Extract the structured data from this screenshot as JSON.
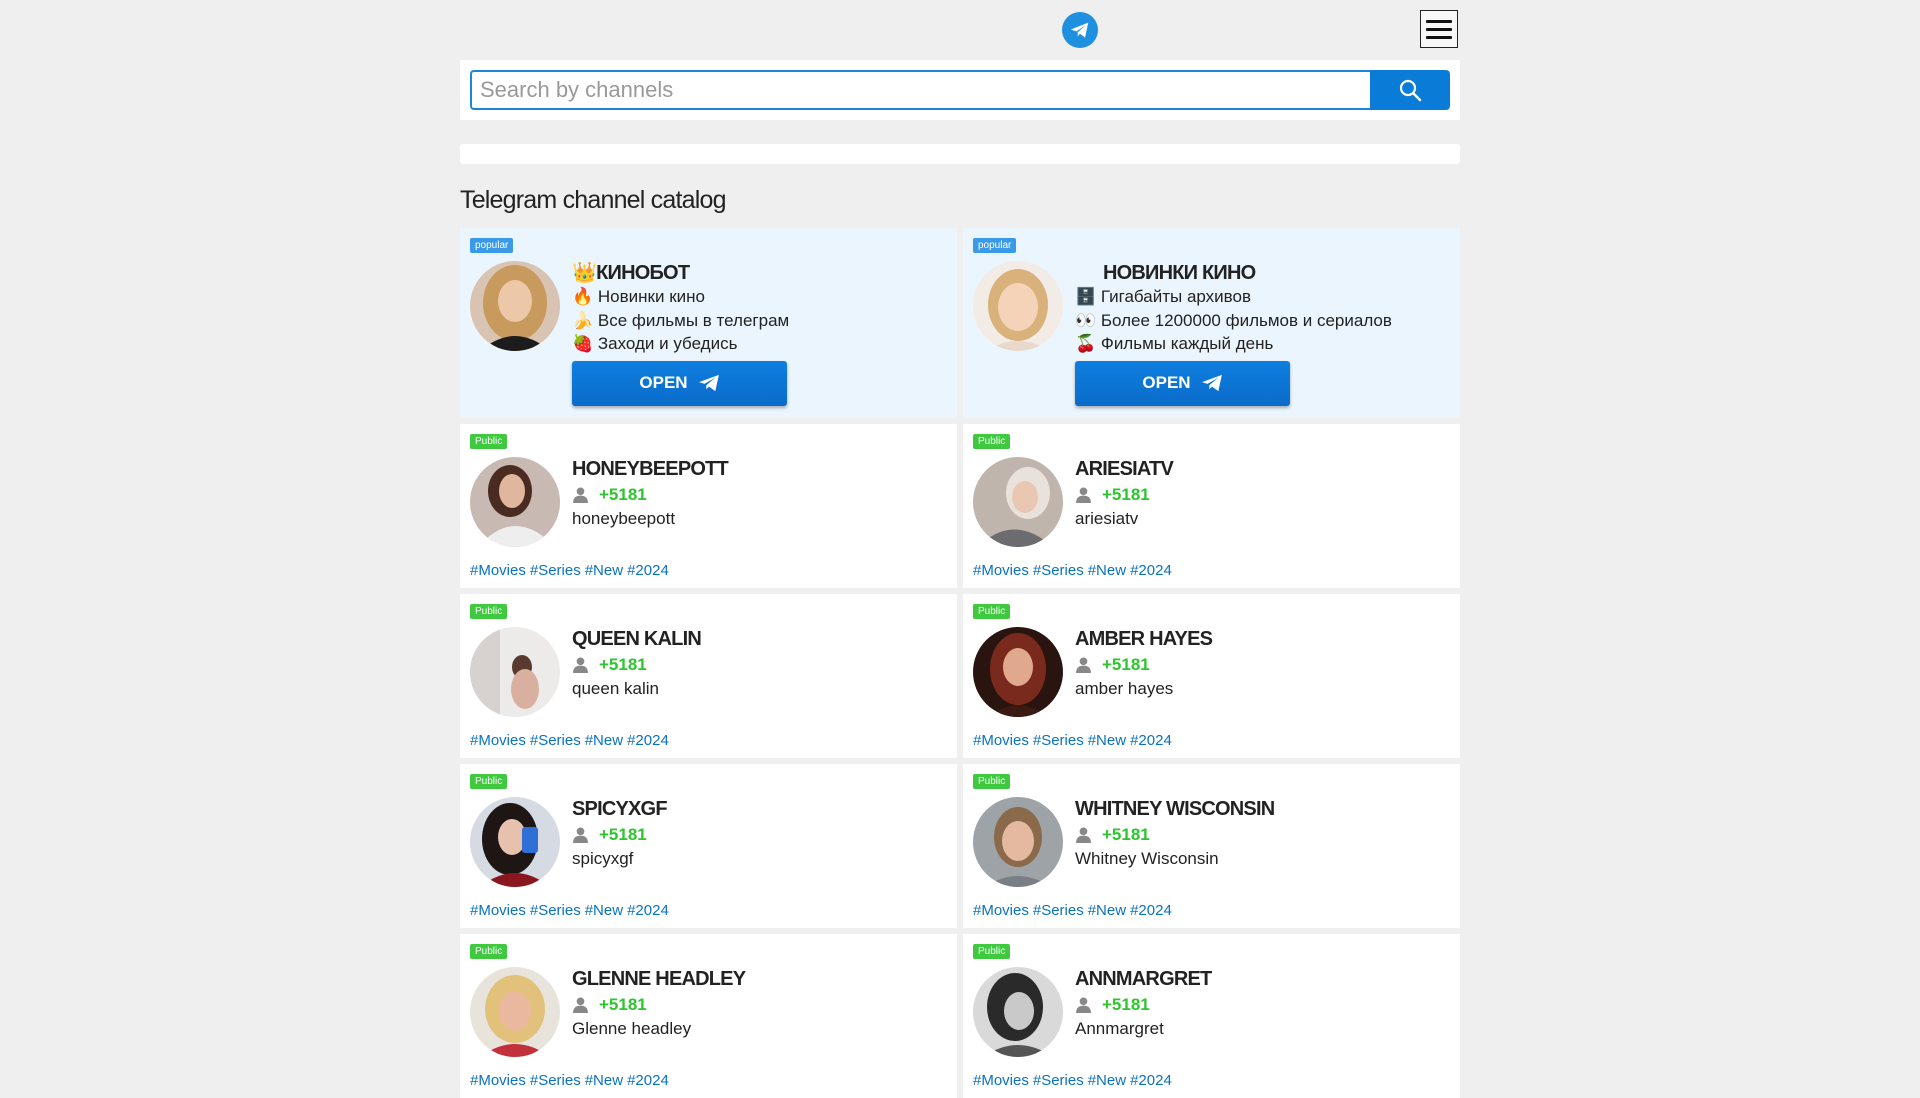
{
  "search": {
    "placeholder": "Search by channels"
  },
  "catalog_title": "Telegram channel catalog",
  "popular": [
    {
      "badge": "popular",
      "title": "👑КИНОБОТ",
      "lines": [
        "🔥 Новинки кино",
        "🍌 Все фильмы в телеграм",
        "🍓 Заходи и убедись"
      ],
      "button": "OPEN"
    },
    {
      "badge": "popular",
      "title": "НОВИНКИ КИНО",
      "lines": [
        "🗄️ Гигабайты архивов",
        "👀 Более 1200000 фильмов и сериалов",
        "🍒 Фильмы каждый день"
      ],
      "button": "OPEN"
    }
  ],
  "channels": [
    {
      "badge": "Public",
      "title": "HONEYBEEPOTT",
      "members": "+5181",
      "username": "honeybeepott",
      "tags": [
        "#Movies",
        "#Series",
        "#New",
        "#2024"
      ]
    },
    {
      "badge": "Public",
      "title": "ARIESIATV",
      "members": "+5181",
      "username": "ariesiatv",
      "tags": [
        "#Movies",
        "#Series",
        "#New",
        "#2024"
      ]
    },
    {
      "badge": "Public",
      "title": "QUEEN KALIN",
      "members": "+5181",
      "username": "queen kalin",
      "tags": [
        "#Movies",
        "#Series",
        "#New",
        "#2024"
      ]
    },
    {
      "badge": "Public",
      "title": "AMBER HAYES",
      "members": "+5181",
      "username": "amber hayes",
      "tags": [
        "#Movies",
        "#Series",
        "#New",
        "#2024"
      ]
    },
    {
      "badge": "Public",
      "title": "SPICYXGF",
      "members": "+5181",
      "username": "spicyxgf",
      "tags": [
        "#Movies",
        "#Series",
        "#New",
        "#2024"
      ]
    },
    {
      "badge": "Public",
      "title": "WHITNEY WISCONSIN",
      "members": "+5181",
      "username": "Whitney Wisconsin",
      "tags": [
        "#Movies",
        "#Series",
        "#New",
        "#2024"
      ]
    },
    {
      "badge": "Public",
      "title": "GLENNE HEADLEY",
      "members": "+5181",
      "username": "Glenne headley",
      "tags": [
        "#Movies",
        "#Series",
        "#New",
        "#2024"
      ]
    },
    {
      "badge": "Public",
      "title": "ANNMARGRET",
      "members": "+5181",
      "username": "Annmargret",
      "tags": [
        "#Movies",
        "#Series",
        "#New",
        "#2024"
      ]
    }
  ],
  "colors": {
    "accent": "#0a7bd6",
    "members": "#2ec52e",
    "tag": "#0a72c0",
    "popular_bg": "#eaf5fd",
    "public_badge": "#3ec93e",
    "popular_badge": "#3b9ae8"
  },
  "icons": {
    "logo": "telegram-logo-icon",
    "menu": "hamburger-menu-icon",
    "search": "search-icon",
    "members": "user-icon",
    "open": "telegram-plane-icon"
  }
}
